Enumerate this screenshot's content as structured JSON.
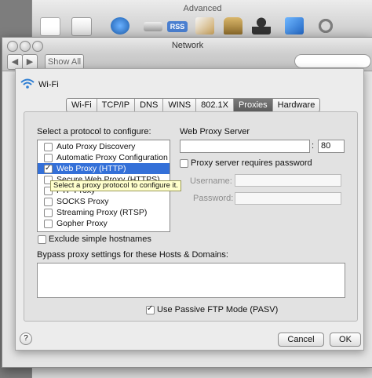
{
  "background_window": {
    "title": "Advanced",
    "toolbar_icons": [
      "general-icon",
      "text-icon",
      "network-icon",
      "drive-icon",
      "rss-icon",
      "pen-icon",
      "lock-icon",
      "user-icon",
      "apps-icon",
      "gear-icon"
    ],
    "rss_label": "RSS"
  },
  "network_window": {
    "title": "Network",
    "nav_back": "◀",
    "nav_forward": "▶",
    "show_all": "Show All"
  },
  "sheet": {
    "interface_name": "Wi-Fi",
    "tabs": [
      "Wi-Fi",
      "TCP/IP",
      "DNS",
      "WINS",
      "802.1X",
      "Proxies",
      "Hardware"
    ],
    "selected_tab": "Proxies",
    "protocol_prompt": "Select a protocol to configure:",
    "protocols": [
      {
        "label": "Auto Proxy Discovery",
        "checked": false,
        "selected": false
      },
      {
        "label": "Automatic Proxy Configuration",
        "checked": false,
        "selected": false
      },
      {
        "label": "Web Proxy (HTTP)",
        "checked": true,
        "selected": true
      },
      {
        "label": "Secure Web Proxy (HTTPS)",
        "checked": false,
        "selected": false
      },
      {
        "label": "FTP Proxy",
        "checked": false,
        "selected": false
      },
      {
        "label": "SOCKS Proxy",
        "checked": false,
        "selected": false
      },
      {
        "label": "Streaming Proxy (RTSP)",
        "checked": false,
        "selected": false
      },
      {
        "label": "Gopher Proxy",
        "checked": false,
        "selected": false
      }
    ],
    "tooltip": "Select a proxy protocol to configure it.",
    "server_label": "Web Proxy Server",
    "server_value": "",
    "port_separator": ":",
    "port_value": "80",
    "requires_password_label": "Proxy server requires password",
    "username_label": "Username:",
    "password_label": "Password:",
    "exclude_simple_label": "Exclude simple hostnames",
    "bypass_label": "Bypass proxy settings for these Hosts & Domains:",
    "bypass_value": "",
    "passive_ftp_label": "Use Passive FTP Mode (PASV)",
    "passive_ftp_checked": true,
    "help": "?",
    "cancel": "Cancel",
    "ok": "OK"
  },
  "colors": {
    "selection": "#3470d8",
    "tab_selected": "#5b5b5b",
    "wifi_icon": "#2f7fd3"
  }
}
